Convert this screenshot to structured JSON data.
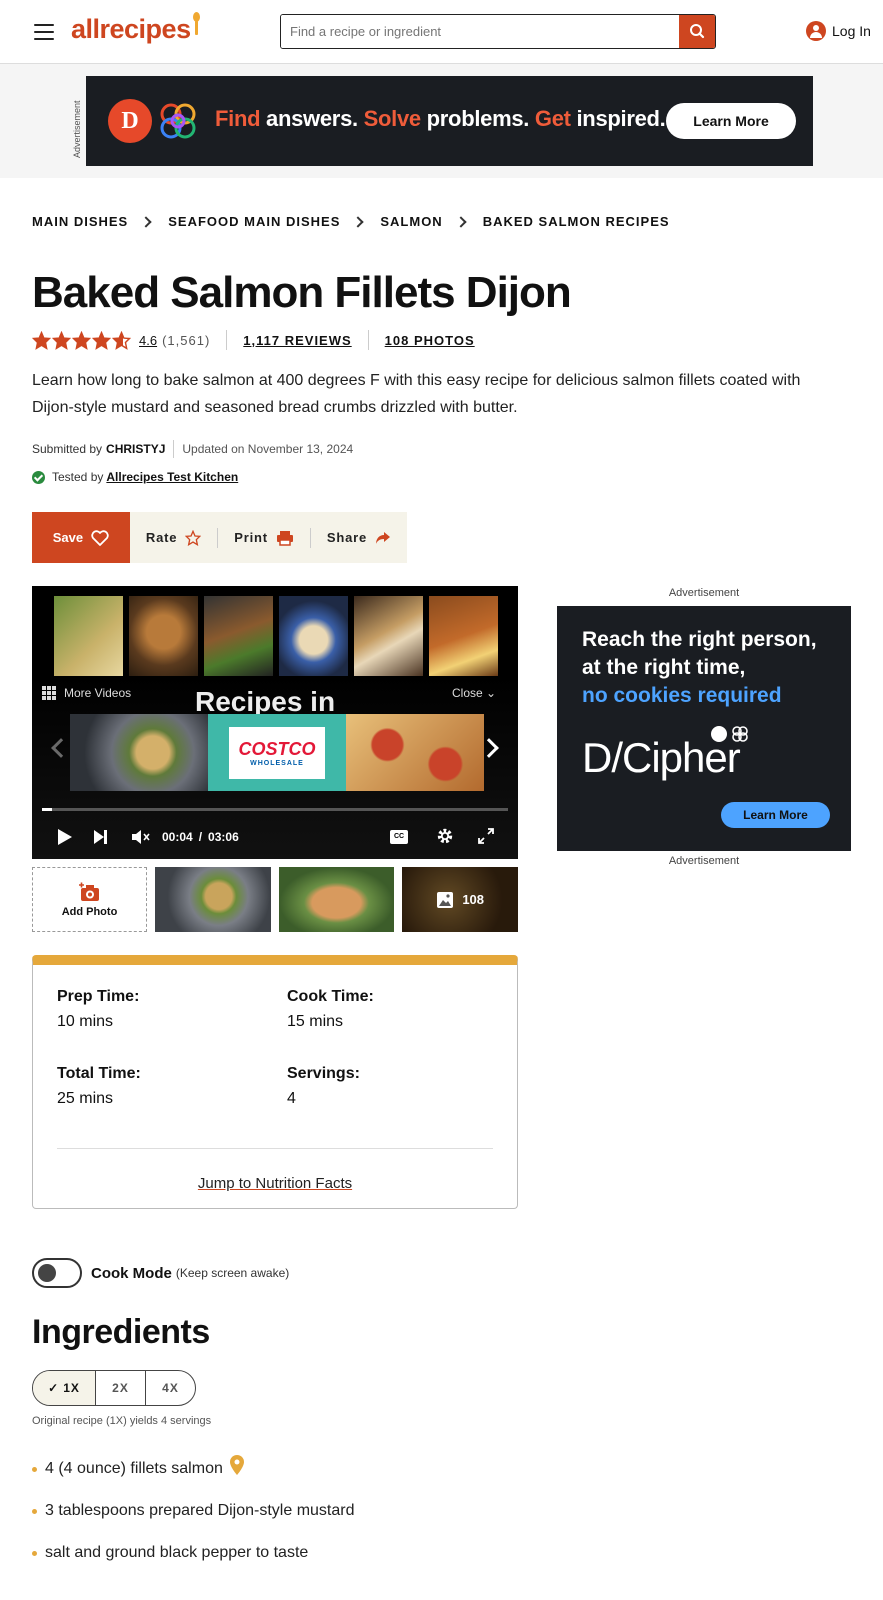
{
  "header": {
    "logo": "allrecipes",
    "search_placeholder": "Find a recipe or ingredient",
    "login_label": "Log In"
  },
  "ad_banner": {
    "side_label": "Advertisement",
    "text_parts": [
      "Find",
      " answers. ",
      "Solve",
      " problems. ",
      "Get",
      " inspired."
    ],
    "button": "Learn More",
    "logo_letter": "D"
  },
  "breadcrumb": [
    "MAIN DISHES",
    "SEAFOOD MAIN DISHES",
    "SALMON",
    "BAKED SALMON RECIPES"
  ],
  "recipe": {
    "title": "Baked Salmon Fillets Dijon",
    "rating": "4.6",
    "rating_value": 4.6,
    "rating_count": "(1,561)",
    "reviews": "1,117 REVIEWS",
    "photos": "108 PHOTOS",
    "description": "Learn how long to bake salmon at 400 degrees F with this easy recipe for delicious salmon fillets coated with Dijon-style mustard and seasoned bread crumbs drizzled with butter.",
    "submitted_label": "Submitted by",
    "author": "CHRISTYJ",
    "updated": "Updated on November 13, 2024",
    "tested_label": "Tested by",
    "tested_by": "Allrecipes Test Kitchen"
  },
  "actions": {
    "save": "Save",
    "rate": "Rate",
    "print": "Print",
    "share": "Share"
  },
  "video": {
    "more_videos": "More Videos",
    "close": "Close",
    "overlay_title": "Recipes in",
    "current_time": "00:04",
    "separator": "/",
    "duration": "03:06",
    "cc": "CC",
    "progress": 0.021,
    "strip_logo": "COSTCO",
    "strip_logo_sub": "WHOLESALE"
  },
  "photo_strip": {
    "add_photo": "Add Photo",
    "count": "108"
  },
  "right_ad": {
    "label_top": "Advertisement",
    "line1": "Reach the right person,",
    "line2": "at the right time,",
    "line3": "no cookies required",
    "brand": "D/Cipher",
    "button": "Learn More",
    "label_bottom": "Advertisement"
  },
  "details": {
    "prep_label": "Prep Time:",
    "prep": "10 mins",
    "cook_label": "Cook Time:",
    "cook": "15 mins",
    "total_label": "Total Time:",
    "total": "25 mins",
    "servings_label": "Servings:",
    "servings": "4",
    "jump": "Jump to Nutrition Facts"
  },
  "cook_mode": {
    "label": "Cook Mode",
    "hint": "(Keep screen awake)"
  },
  "ingredients": {
    "heading": "Ingredients",
    "scales": [
      "1X",
      "2X",
      "4X"
    ],
    "active_scale": "1X",
    "yield_note": "Original recipe (1X) yields 4 servings",
    "items": [
      "4 (4 ounce) fillets salmon",
      "3 tablespoons prepared Dijon-style mustard",
      "salt and ground black pepper to taste"
    ]
  },
  "colors": {
    "brand": "#ce4620",
    "accent": "#e5a83b",
    "ad_dark": "#1a1d22",
    "ad_blue": "#4da3ff"
  }
}
